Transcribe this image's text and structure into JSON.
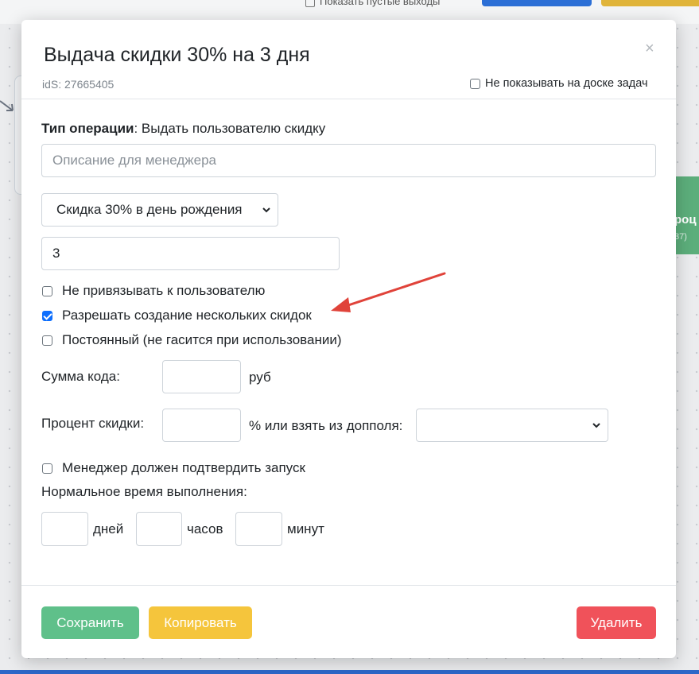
{
  "background": {
    "top_label": "Показать пустые выходы",
    "green_card_text": "роц",
    "green_card_sub": "37)"
  },
  "modal": {
    "title": "Выдача скидки 30% на 3 дня",
    "ids": "idS: 27665405",
    "close": "×",
    "hide_board_label": "Не показывать на доске задач",
    "hide_board_checked": false
  },
  "form": {
    "operation_type_label": "Тип операции",
    "operation_type_value": ": Выдать пользователю скидку",
    "description_placeholder": "Описание для менеджера",
    "discount_select_value": "Скидка 30% в день рождения",
    "days_value": "3",
    "checkboxes": [
      {
        "label": "Не привязывать к пользователю",
        "checked": false
      },
      {
        "label": "Разрешать создание нескольких скидок",
        "checked": true
      },
      {
        "label": "Постоянный (не гасится при использовании)",
        "checked": false
      }
    ],
    "sum_label": "Сумма кода:",
    "sum_unit": "руб",
    "percent_label": "Процент скидки:",
    "percent_or_label": "% или взять из допполя:",
    "manager_confirm_label": "Менеджер должен подтвердить запуск",
    "manager_confirm_checked": false,
    "normal_time_label": "Нормальное время выполнения:",
    "days_unit": "дней",
    "hours_unit": "часов",
    "minutes_unit": "минут"
  },
  "footer": {
    "save_label": "Сохранить",
    "copy_label": "Копировать",
    "delete_label": "Удалить"
  },
  "colors": {
    "save": "#5fc08a",
    "copy": "#f5c53c",
    "delete": "#f0525a",
    "checkbox_checked": "#0d6efd",
    "annotation_arrow": "#e0433a"
  },
  "icons": {
    "close": "close-icon",
    "select_chevron": "chevron-down-icon",
    "annotation": "red-arrow-annotation"
  }
}
